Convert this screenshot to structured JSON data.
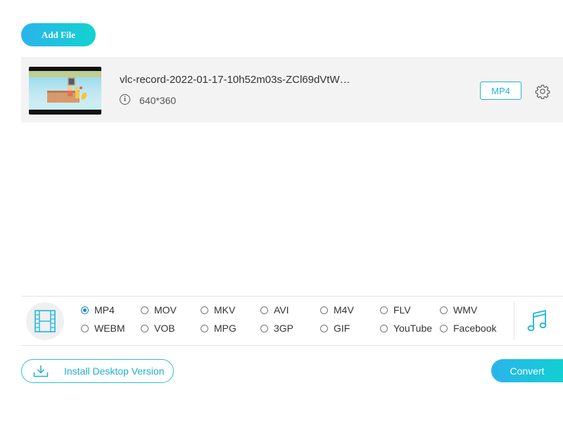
{
  "toolbar": {
    "add_file_label": "Add File"
  },
  "file": {
    "name": "vlc-record-2022-01-17-10h52m03s-ZCl69dVtW…",
    "resolution": "640*360",
    "output_format": "MP4",
    "thumbnail_icon": "video-thumbnail",
    "info_icon": "info-icon",
    "settings_icon": "gear-icon"
  },
  "formats": {
    "selected": "MP4",
    "video_icon": "film-icon",
    "audio_icon": "music-note-icon",
    "row1": [
      "MP4",
      "MOV",
      "MKV",
      "AVI",
      "M4V",
      "FLV",
      "WMV"
    ],
    "row2": [
      "WEBM",
      "VOB",
      "MPG",
      "3GP",
      "GIF",
      "YouTube",
      "Facebook"
    ]
  },
  "footer": {
    "install_label": "Install Desktop Version",
    "install_icon": "download-icon",
    "convert_label": "Convert"
  },
  "colors": {
    "accent": "#1fb6dd",
    "gradient_start": "#2ab4ec",
    "gradient_end": "#12d3cf",
    "radio_selected": "#1c86d6"
  }
}
